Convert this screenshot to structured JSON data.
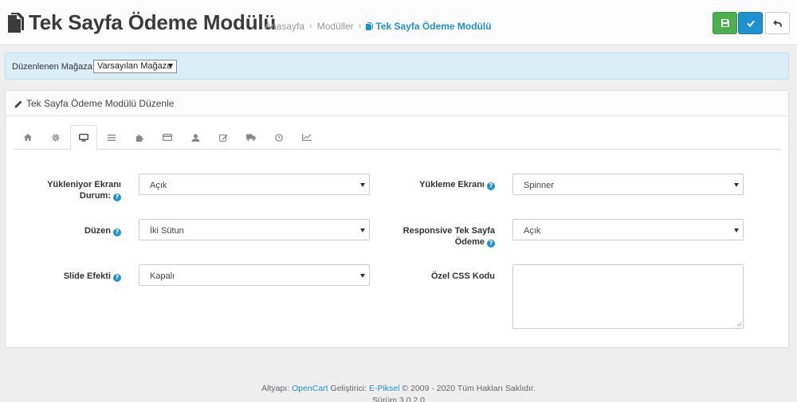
{
  "header": {
    "title": "Tek Sayfa Ödeme Modülü",
    "breadcrumb": [
      "Anasayfa",
      "Modüller",
      "Tek Sayfa Ödeme Modülü"
    ],
    "buttons": {
      "save": "save-icon",
      "apply": "check-icon",
      "back": "back-arrow-icon"
    }
  },
  "store": {
    "label": "Düzenlenen Mağaza:",
    "selected": "Varsayılan Mağaza"
  },
  "panel": {
    "title": "Tek Sayfa Ödeme Modülü Düzenle",
    "tabs": [
      "home-icon",
      "gear-icon",
      "monitor-icon",
      "list-icon",
      "puzzle-icon",
      "credit-card-icon",
      "user-icon",
      "edit-icon",
      "truck-icon",
      "clock-icon",
      "chart-icon"
    ],
    "active_tab": 2
  },
  "form": {
    "loading_status": {
      "label_line1": "Yükleniyor Ekranı",
      "label_line2": "Durum:",
      "value": "Açık"
    },
    "loading_screen": {
      "label": "Yükleme Ekranı",
      "value": "Spinner"
    },
    "layout": {
      "label": "Düzen",
      "value": "İki Sütun"
    },
    "responsive": {
      "label_line1": "Responsive Tek Sayfa",
      "label_line2": "Ödeme",
      "value": "Açık"
    },
    "slide_effect": {
      "label": "Slide Efekti",
      "value": "Kapalı"
    },
    "custom_css": {
      "label": "Özel CSS Kodu",
      "value": ""
    }
  },
  "footer": {
    "prefix": "Altyapı:",
    "platform": "OpenCart",
    "dev_label": "Geliştirici:",
    "developer": "E-Piksel",
    "copyright": "© 2009 - 2020 Tüm Hakları Saklıdır.",
    "version": "Sürüm 3.0.2.0"
  },
  "colors": {
    "primary": "#1e91cf",
    "success": "#4cae4c",
    "info_bg": "#d9eef7"
  }
}
